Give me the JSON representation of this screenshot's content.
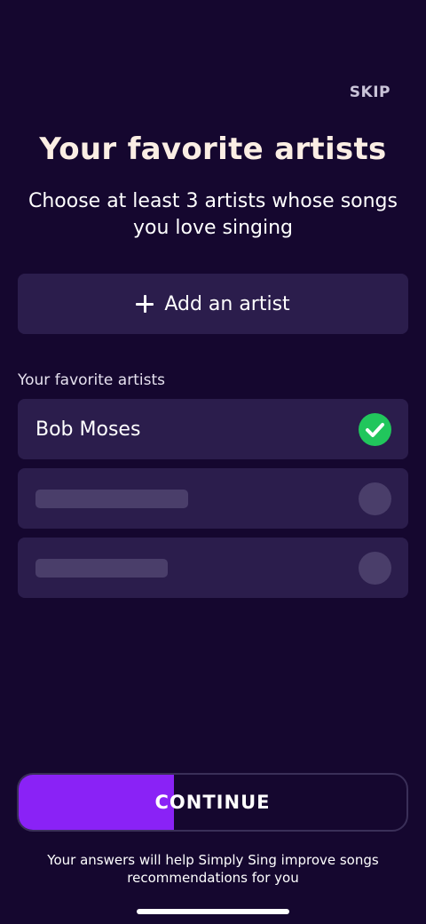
{
  "header": {
    "skip_label": "SKIP"
  },
  "title": "Your favorite artists",
  "subtitle": "Choose at least 3 artists whose songs you love singing",
  "add_artist": {
    "label": "Add an artist",
    "icon": "plus-icon"
  },
  "favorites": {
    "section_label": "Your favorite artists",
    "items": [
      {
        "name": "Bob Moses",
        "selected": true,
        "icon": "check-icon"
      }
    ],
    "empty_slots": 2
  },
  "continue_button": {
    "label": "CONTINUE",
    "progress": 0.4,
    "fill_color": "#8a22f6"
  },
  "footnote": "Your answers will help Simply Sing improve songs recommendations for you",
  "colors": {
    "background": "#15072f",
    "card": "#2b1d4c",
    "placeholder": "#4a3e6a",
    "success": "#21c65c",
    "title": "#fbeee4"
  }
}
